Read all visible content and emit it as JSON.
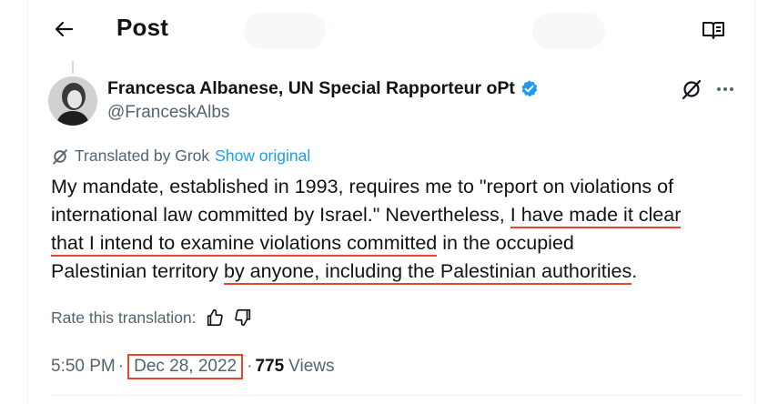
{
  "header": {
    "title": "Post"
  },
  "author": {
    "name": "Francesca Albanese, UN Special Rapporteur oPt",
    "handle": "@FranceskAlbs"
  },
  "translation": {
    "label": "Translated by Grok",
    "show_original": "Show original"
  },
  "post": {
    "lines": [
      {
        "pre": "My mandate, established in 1993, requires me to \"report on violations of",
        "hl": "",
        "post": ""
      },
      {
        "pre": "international law committed by Israel.\" Nevertheless, ",
        "hl": "I have made it clear",
        "post": ""
      },
      {
        "pre": "",
        "hl": "that I intend to examine violations committed",
        "post": " in the occupied"
      },
      {
        "pre": "Palestinian territory ",
        "hl": "by anyone, including the Palestinian authorities",
        "post": "."
      }
    ]
  },
  "rate": {
    "label": "Rate this translation:"
  },
  "meta": {
    "time": "5:50 PM",
    "date": "Dec 28, 2022",
    "views_count": "775",
    "views_label": "Views"
  },
  "colors": {
    "accent": "#1d9bf0",
    "annotation": "#e8452c",
    "secondary_text": "#536471",
    "primary_text": "#0f1419"
  }
}
